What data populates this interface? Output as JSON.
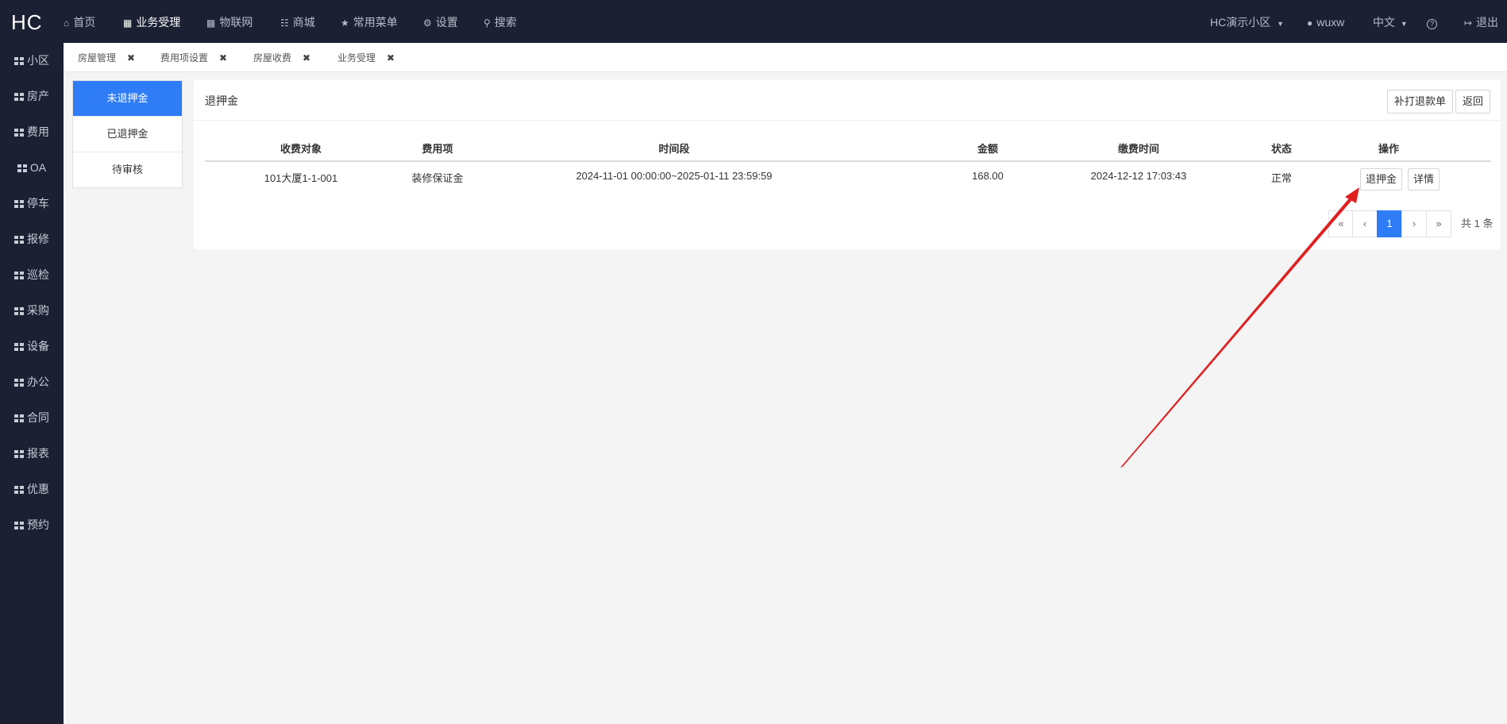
{
  "topbar": {
    "logo": "HC",
    "nav": [
      {
        "label": "首页",
        "icon": "home-icon"
      },
      {
        "label": "业务受理",
        "icon": "calculator-icon"
      },
      {
        "label": "物联网",
        "icon": "car-icon"
      },
      {
        "label": "商城",
        "icon": "cart-icon"
      },
      {
        "label": "常用菜单",
        "icon": "sitemap-icon"
      },
      {
        "label": "设置",
        "icon": "gear-icon"
      },
      {
        "label": "搜索",
        "icon": "search-icon"
      }
    ],
    "community": "HC演示小区",
    "user": "wuxw",
    "language": "中文",
    "logout": "退出"
  },
  "sidebar": {
    "items": [
      "小区",
      "房产",
      "费用",
      "OA",
      "停车",
      "报修",
      "巡检",
      "采购",
      "设备",
      "办公",
      "合同",
      "报表",
      "优惠",
      "预约"
    ]
  },
  "tabs": [
    "房屋管理",
    "费用项设置",
    "房屋收费",
    "业务受理"
  ],
  "subnav": {
    "items": [
      "未退押金",
      "已退押金",
      "待审核"
    ]
  },
  "panel": {
    "title": "退押金",
    "reprint_button": "补打退款单",
    "back_button": "返回"
  },
  "table": {
    "headers": [
      "收费对象",
      "费用项",
      "时间段",
      "金额",
      "缴费时间",
      "状态",
      "操作"
    ],
    "rows": [
      {
        "object": "101大厦1-1-001",
        "fee_item": "装修保证金",
        "period": "2024-11-01 00:00:00~2025-01-11 23:59:59",
        "amount": "168.00",
        "pay_time": "2024-12-12 17:03:43",
        "status": "正常",
        "action_refund": "退押金",
        "action_detail": "详情"
      }
    ]
  },
  "pagination": {
    "first": "«",
    "prev": "‹",
    "current": "1",
    "next": "›",
    "last": "»",
    "total": "共 1 条"
  },
  "colors": {
    "topbar_bg": "#1b2033",
    "accent": "#2e7cf6",
    "annotation_arrow": "#e02020"
  }
}
